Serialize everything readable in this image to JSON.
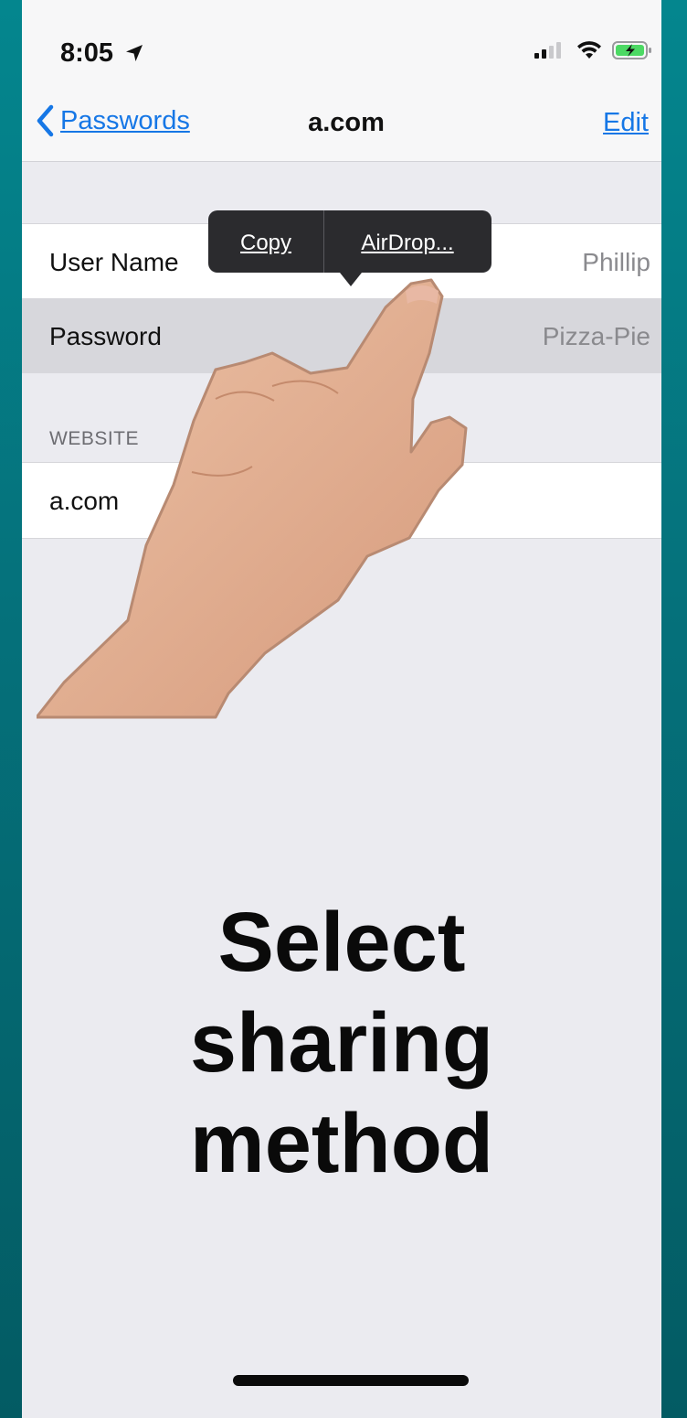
{
  "status_bar": {
    "time": "8:05"
  },
  "nav": {
    "back_label": "Passwords",
    "title": "a.com",
    "edit_label": "Edit"
  },
  "rows": {
    "username": {
      "label": "User Name",
      "value": "Phillip"
    },
    "password": {
      "label": "Password",
      "value": "Pizza-Pie"
    },
    "website_header": "WEBSITE",
    "website": {
      "value": "a.com"
    }
  },
  "popover": {
    "copy_label": "Copy",
    "airdrop_label": "AirDrop..."
  },
  "instruction": {
    "line1": "Select",
    "line2": "sharing",
    "line3": "method"
  },
  "colors": {
    "accent": "#1677e6",
    "background_outer": "#04868e",
    "popover_bg": "#2b2b2e"
  }
}
